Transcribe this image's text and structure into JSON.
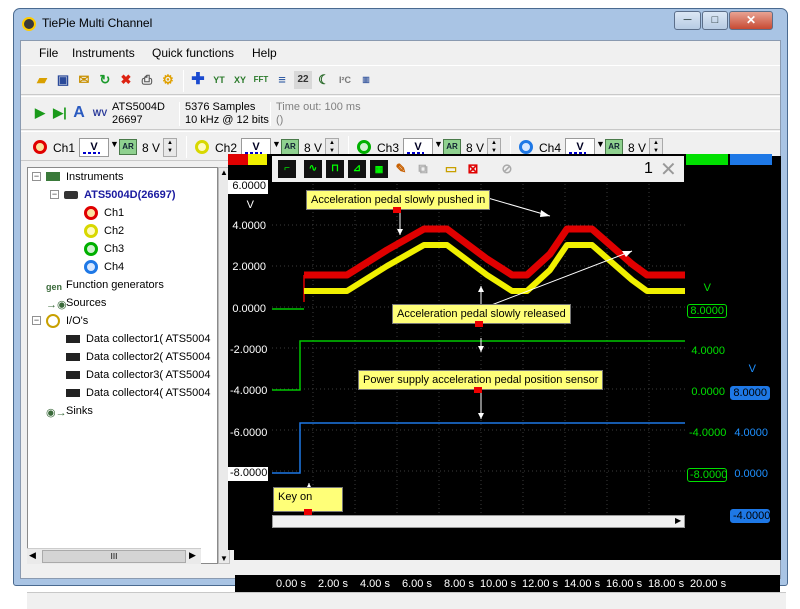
{
  "window": {
    "title": "TiePie Multi Channel",
    "minimize": "─",
    "maximize": "□",
    "close": "✕"
  },
  "menu": [
    "File",
    "Instruments",
    "Quick functions",
    "Help"
  ],
  "toolbar1": {
    "icons": [
      "open-folder-icon",
      "save-icon",
      "email-icon",
      "refresh-icon",
      "delete-icon",
      "print-icon",
      "settings-icon",
      "add-icon",
      "chart-yt-icon",
      "chart-xy-icon",
      "chart-fft-icon",
      "meter-icon",
      "display-icon",
      "moon-icon",
      "i2c-icon",
      "bus-icon"
    ]
  },
  "toolbar2": {
    "instrument": "ATS5004D",
    "serial": "26697",
    "samples": "5376 Samples",
    "rate": "10 kHz @ 12 bits",
    "timeout": "Time out: 100 ms",
    "extra": "()"
  },
  "channels": [
    {
      "name": "Ch1",
      "coupling": "V",
      "auto": "AR",
      "range": "8 V",
      "color": "#e00000"
    },
    {
      "name": "Ch2",
      "coupling": "V",
      "auto": "AR",
      "range": "8 V",
      "color": "#e6e600"
    },
    {
      "name": "Ch3",
      "coupling": "V",
      "auto": "AR",
      "range": "8 V",
      "color": "#00c000"
    },
    {
      "name": "Ch4",
      "coupling": "V",
      "auto": "AR",
      "range": "8 V",
      "color": "#1e78e6"
    }
  ],
  "tree": {
    "items": [
      {
        "label": "Instruments"
      },
      {
        "label": "ATS5004D(26697)"
      },
      {
        "label": "Ch1"
      },
      {
        "label": "Ch2"
      },
      {
        "label": "Ch3"
      },
      {
        "label": "Ch4"
      },
      {
        "label": "Function generators"
      },
      {
        "label": "Sources"
      },
      {
        "label": "I/O's"
      },
      {
        "label": "Data collector1( ATS5004"
      },
      {
        "label": "Data collector2( ATS5004"
      },
      {
        "label": "Data collector3( ATS5004"
      },
      {
        "label": "Data collector4( ATS5004"
      },
      {
        "label": "Sinks"
      }
    ],
    "scroll_grip": "III"
  },
  "scope": {
    "graph_number": "1",
    "y_unit_left": "V",
    "y_left_top": "6.0000",
    "y_left_bottom": "-8.0000",
    "y_left_ticks": [
      "4.0000",
      "2.0000",
      "0.0000",
      "-2.0000",
      "-4.0000",
      "-6.0000"
    ],
    "ch3_unit": "V",
    "ch3_top": "8.0000",
    "ch3_ticks": [
      "4.0000",
      "0.0000",
      "-4.0000"
    ],
    "ch3_bottom": "-8.0000",
    "ch4_unit": "V",
    "ch4_top": "8.0000",
    "ch4_ticks": [
      "4.0000",
      "0.0000"
    ],
    "ch4_bottom": "-4.0000",
    "x_ticks": [
      "0.00 s",
      "2.00 s",
      "4.00 s",
      "6.00 s",
      "8.00 s",
      "10.00 s",
      "12.00 s",
      "14.00 s",
      "16.00 s",
      "18.00 s",
      "20.00 s"
    ]
  },
  "annotations": [
    "Acceleration pedal slowly pushed in",
    "Acceleration pedal slowly released",
    "Power supply acceleration pedal position sensor",
    "Key on"
  ]
}
